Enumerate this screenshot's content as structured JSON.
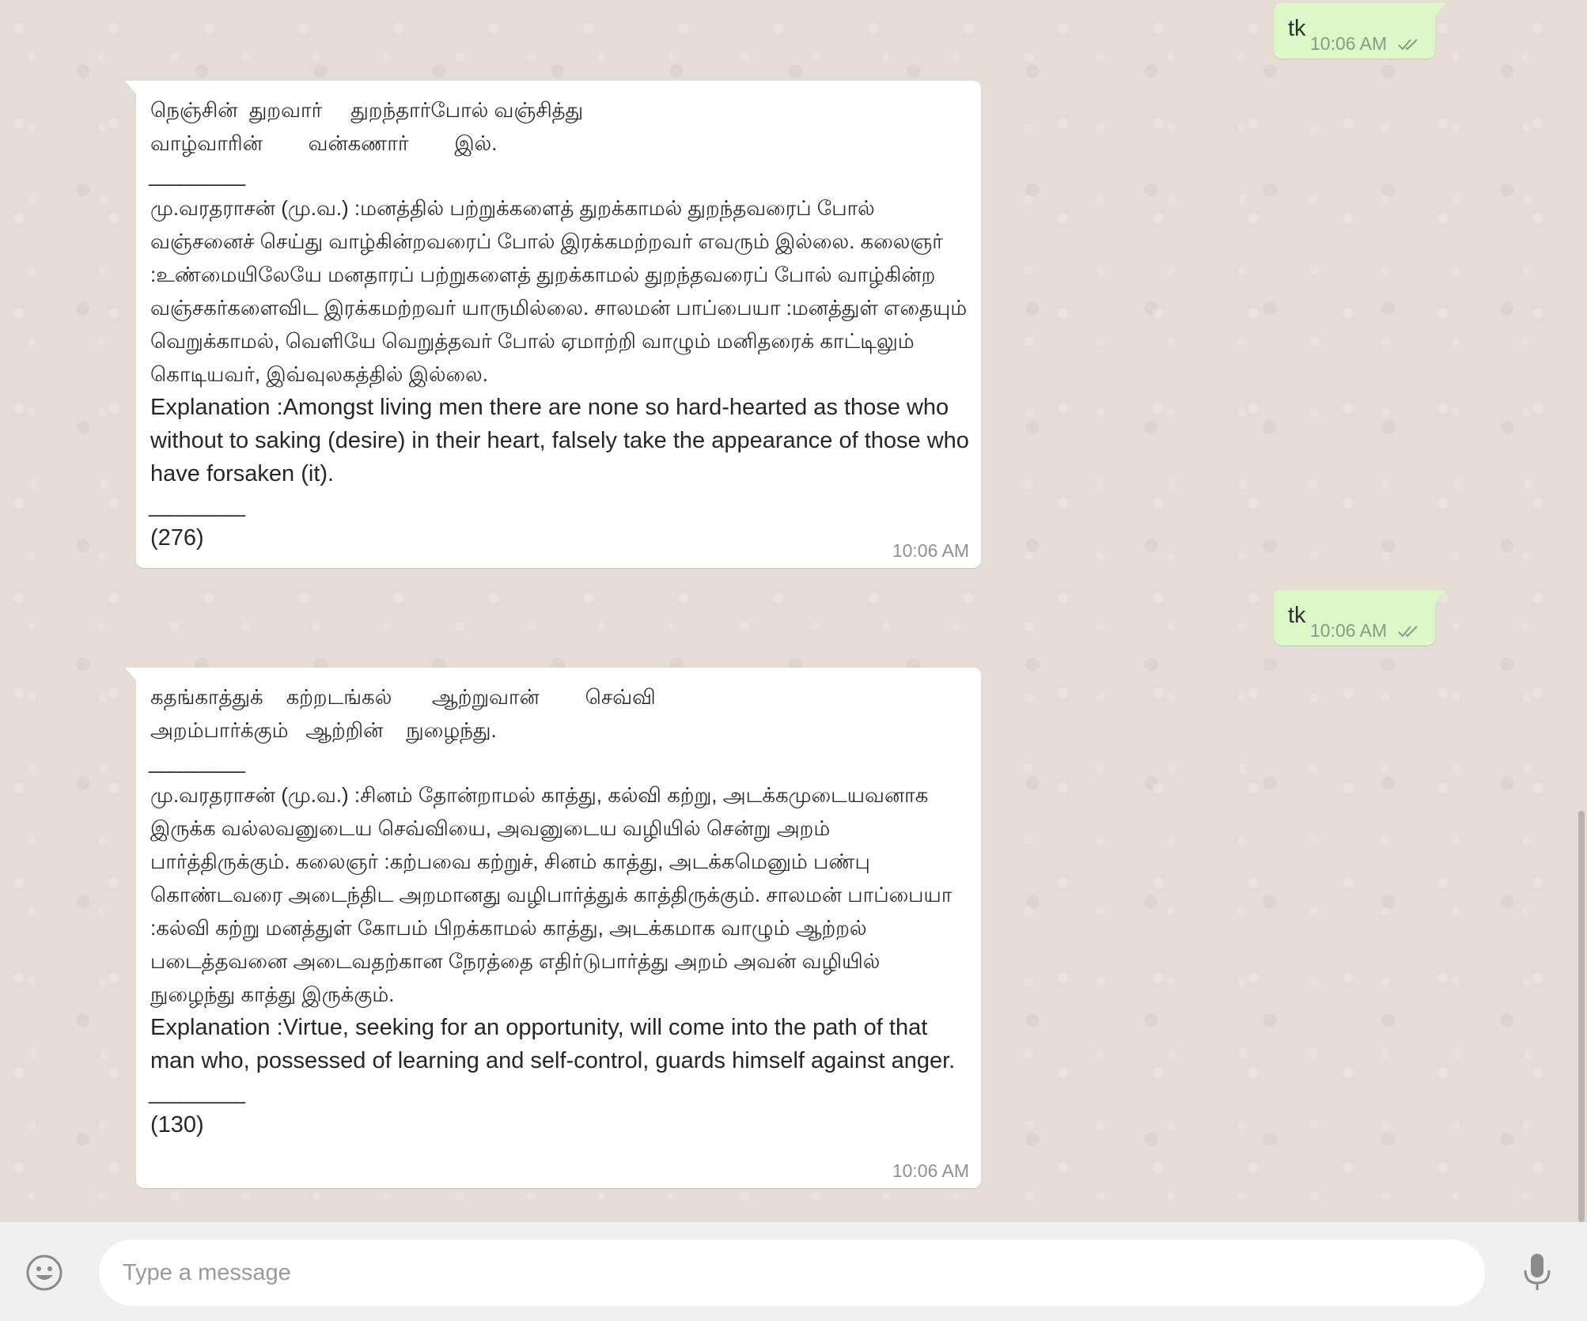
{
  "messages": [
    {
      "direction": "outgoing",
      "text": "tk",
      "time": "10:06 AM",
      "status": "double-check-read"
    },
    {
      "direction": "incoming",
      "verse_line_1": "நெஞ்சின்  துறவார்     துறந்தார்போல் வஞ்சித்து",
      "verse_line_2": "வாழ்வாரின்        வன்கணார்        இல்.",
      "separator": "_________",
      "tamil_explanation": "மு.வரதராசன் (மு.வ.) :மனத்தில் பற்றுக்களைத் துறக்காமல் துறந்தவரைப் போல் வஞ்சனைச் செய்து வாழ்கின்றவரைப் போல் இரக்கமற்றவர் எவரும் இல்லை. கலைஞர் :உண்மையிலேயே மனதாரப் பற்றுகளைத் துறக்காமல் துறந்தவரைப் போல் வாழ்கின்ற வஞ்சகர்களைவிட இரக்கமற்றவர் யாருமில்லை. சாலமன் பாப்பையா :மனத்துள் எதையும் வெறுக்காமல், வெளியே வெறுத்தவர் போல் ஏமாற்றி வாழும் மனிதரைக் காட்டிலும் கொடியவர், இவ்வுலகத்தில் இல்லை.",
      "english_explanation": "Explanation :Amongst living men there are none so hard-hearted as those who without to saking (desire) in their heart, falsely take the appearance of those who have forsaken (it).",
      "number": "(276)",
      "time": "10:06 AM"
    },
    {
      "direction": "outgoing",
      "text": "tk",
      "time": "10:06 AM",
      "status": "double-check-read"
    },
    {
      "direction": "incoming",
      "verse_line_1": "கதங்காத்துக்    கற்றடங்கல்       ஆற்றுவான்        செவ்வி",
      "verse_line_2": "அறம்பார்க்கும்   ஆற்றின்    நுழைந்து.",
      "separator": "_________",
      "tamil_explanation": "மு.வரதராசன் (மு.வ.) :சினம் தோன்றாமல் காத்து, கல்வி கற்று, அடக்கமுடையவனாக இருக்க வல்லவனுடைய செவ்வியை, அவனுடைய வழியில் சென்று அறம் பார்த்திருக்கும். கலைஞர் :கற்பவை கற்றுச், சினம் காத்து, அடக்கமெனும் பண்பு கொண்டவரை அடைந்திட அறமானது வழிபார்த்துக் காத்திருக்கும். சாலமன் பாப்பையா :கல்வி கற்று மனத்துள் கோபம் பிறக்காமல் காத்து, அடக்கமாக வாழும் ஆற்றல் படைத்தவனை அடைவதற்கான நேரத்தை எதிர்டுபார்த்து அறம் அவன் வழியில் நுழைந்து காத்து இருக்கும்.",
      "english_explanation": "Explanation :Virtue, seeking for an opportunity, will come into the path of that man who, possessed of learning and self-control, guards himself against anger.",
      "number": "(130)",
      "time": "10:06 AM"
    }
  ],
  "composer": {
    "placeholder": "Type a message",
    "value": "",
    "emoji_icon": "smiley-icon",
    "mic_icon": "microphone-icon"
  },
  "colors": {
    "chat_background": "#e5ddd5",
    "outgoing_bubble": "#dcf8c6",
    "incoming_bubble": "#ffffff",
    "footer_background": "#f0f0f0",
    "read_tick": "#8a9a84"
  }
}
